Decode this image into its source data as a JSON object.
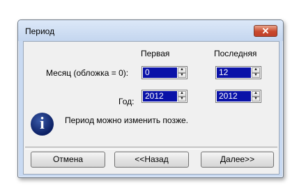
{
  "window": {
    "title": "Период",
    "close_label": "✕"
  },
  "columns": {
    "first": "Первая",
    "last": "Последняя"
  },
  "month": {
    "label": "Месяц (обложка = 0):",
    "first_value": "0",
    "last_value": "12"
  },
  "year": {
    "label": "Год:",
    "first_value": "2012",
    "last_value": "2012"
  },
  "info": {
    "text": "Период можно изменить позже.",
    "icon": "info-icon"
  },
  "buttons": {
    "cancel": "Отмена",
    "back": "<<Назад",
    "next": "Далее>>"
  },
  "spin_arrows": {
    "up": "▲",
    "down": "▼"
  }
}
